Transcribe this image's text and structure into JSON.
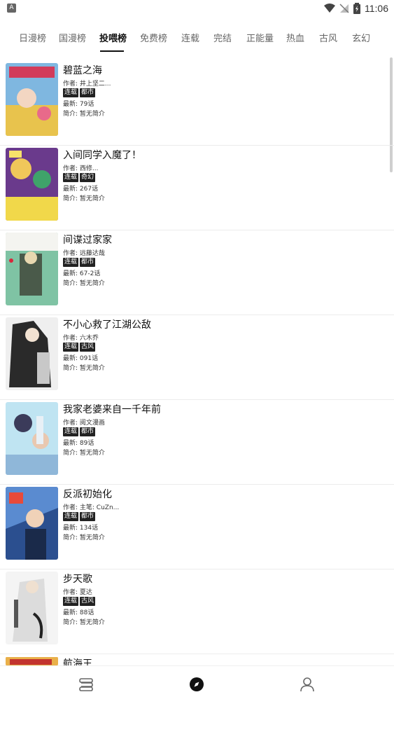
{
  "status_bar": {
    "app_icon": "A",
    "time": "11:06"
  },
  "tabs": [
    {
      "label": "日漫榜"
    },
    {
      "label": "国漫榜"
    },
    {
      "label": "投喂榜"
    },
    {
      "label": "免费榜"
    },
    {
      "label": "连载"
    },
    {
      "label": "完结"
    },
    {
      "label": "正能量"
    },
    {
      "label": "热血"
    },
    {
      "label": "古风"
    },
    {
      "label": "玄幻"
    }
  ],
  "active_tab": "投喂榜",
  "comics": [
    {
      "title": "碧蓝之海",
      "author": "作者: 井上坚二...",
      "tags": [
        "连载",
        "都市"
      ],
      "latest": "最新: 79话",
      "intro": "简介: 暂无简介"
    },
    {
      "title": "入间同学入魔了！",
      "author": "作者: 西修...",
      "tags": [
        "连载",
        "奇幻"
      ],
      "latest": "最新: 267话",
      "intro": "简介: 暂无简介"
    },
    {
      "title": "间谍过家家",
      "author": "作者: 远藤达哉",
      "tags": [
        "连载",
        "都市"
      ],
      "latest": "最新: 67-2话",
      "intro": "简介: 暂无简介"
    },
    {
      "title": "不小心救了江湖公敌",
      "author": "作者: 六木乔",
      "tags": [
        "连载",
        "古风"
      ],
      "latest": "最新: 091话",
      "intro": "简介: 暂无简介"
    },
    {
      "title": "我家老婆来自一千年前",
      "author": "作者: 阅文漫画",
      "tags": [
        "连载",
        "都市"
      ],
      "latest": "最新: 89话",
      "intro": "简介: 暂无简介"
    },
    {
      "title": "反派初始化",
      "author": "作者: 主笔: CuZn...",
      "tags": [
        "连载",
        "都市"
      ],
      "latest": "最新: 134话",
      "intro": "简介: 暂无简介"
    },
    {
      "title": "步天歌",
      "author": "作者: 夏达",
      "tags": [
        "连载",
        "古风"
      ],
      "latest": "最新: 88话",
      "intro": "简介: 暂无简介"
    },
    {
      "title": "航海王",
      "author": "",
      "tags": [],
      "latest": "",
      "intro": ""
    }
  ],
  "bottom_nav": [
    "bookshelf-icon",
    "discover-compass-icon",
    "profile-icon"
  ],
  "colors": {
    "accent": "#111111",
    "tag_bg": "#222222",
    "divider": "#ececec"
  }
}
